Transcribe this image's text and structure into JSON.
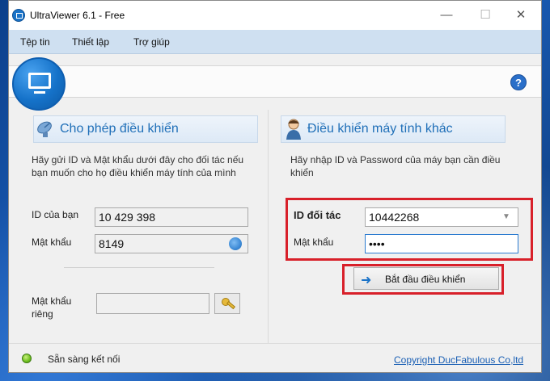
{
  "window": {
    "title": "UltraViewer 6.1 - Free",
    "min_glyph": "—",
    "max_glyph": "☐",
    "close_glyph": "✕"
  },
  "menu": [
    "Tệp tin",
    "Thiết lập",
    "Trợ giúp"
  ],
  "help_glyph": "?",
  "allow_control": {
    "title": "Cho phép điều khiển",
    "description": "Hãy gửi ID và Mật khẩu dưới đây cho đối tác nếu bạn muốn cho họ điều khiển máy tính của mình",
    "id_label": "ID của bạn",
    "id_value": "10 429 398",
    "password_label": "Mật khẩu",
    "password_value": "8149",
    "private_password_label": "Mật khẩu riêng",
    "private_password_value": ""
  },
  "remote_control": {
    "title": "Điều khiển máy tính khác",
    "description": "Hãy nhập ID và Password của máy bạn cần điều khiển",
    "partner_id_label": "ID đối tác",
    "partner_id_value": "10442268",
    "password_label": "Mật khẩu",
    "password_value": "••••",
    "start_button": "Bắt đầu điều khiển",
    "start_arrow": "➜"
  },
  "status": {
    "text": "Sẵn sàng kết nối",
    "copyright": "Copyright DucFabulous Co,ltd"
  },
  "colors": {
    "accent": "#1f6fb8",
    "highlight": "#d8202a",
    "status_ok": "#6fbf1f"
  }
}
